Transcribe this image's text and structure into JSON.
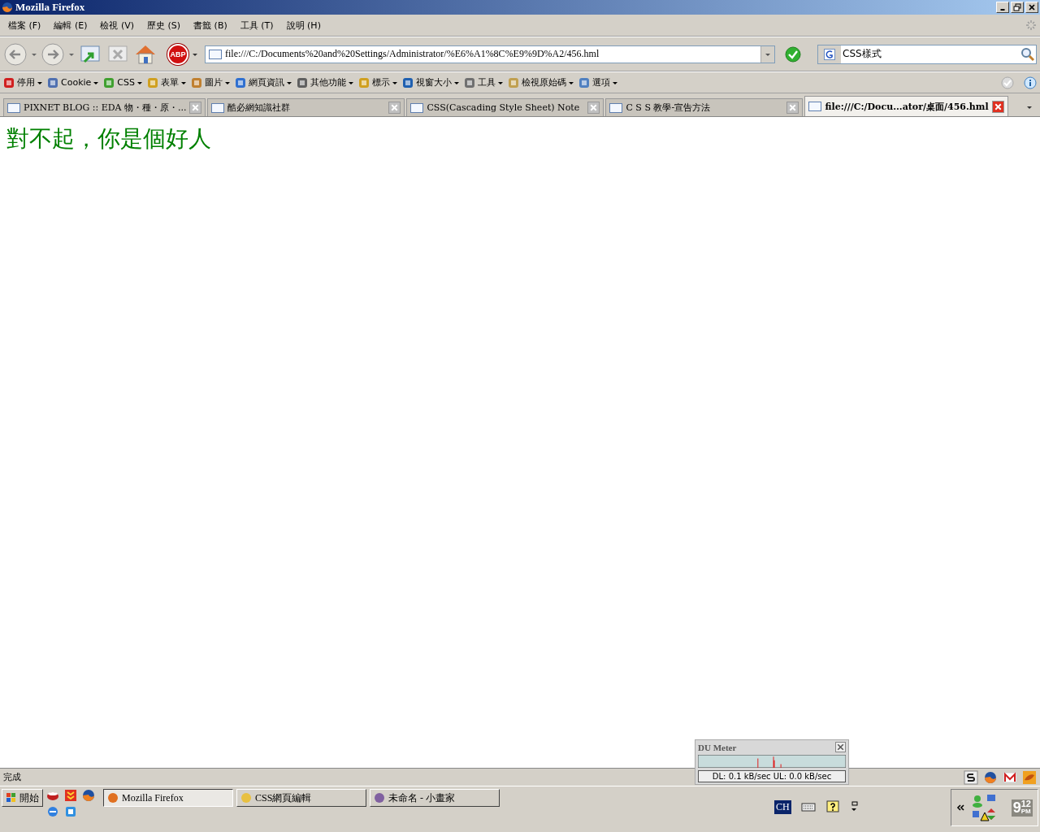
{
  "window": {
    "title": "Mozilla Firefox"
  },
  "menu": [
    "檔案 (F)",
    "編輯 (E)",
    "檢視 (V)",
    "歷史 (S)",
    "書籤 (B)",
    "工具 (T)",
    "說明 (H)"
  ],
  "navbar": {
    "adblock_label": "ABP",
    "address": "file:///C:/Documents%20and%20Settings/Administrator/%E6%A1%8C%E9%9D%A2/456.hml",
    "search_value": "CSS樣式"
  },
  "bookmarks": [
    "停用",
    "Cookie",
    "CSS",
    "表單",
    "圖片",
    "網頁資訊",
    "其他功能",
    "標示",
    "視窗大小",
    "工具",
    "檢視原始碼",
    "選項"
  ],
  "tabs": [
    {
      "label": "PIXNET BLOG :: EDA 物・種・原・...",
      "selected": false
    },
    {
      "label": "酷必網知識社群",
      "selected": false
    },
    {
      "label": "CSS(Cascading Style Sheet) Note",
      "selected": false
    },
    {
      "label": "C S S 教學-宣告方法",
      "selected": false
    },
    {
      "label": "file:///C:/Docu...ator/桌面/456.hml",
      "selected": true
    }
  ],
  "page": {
    "heading": "對不起，你是個好人"
  },
  "du_meter": {
    "title": "DU Meter",
    "reading": "DL: 0.1 kB/sec  UL: 0.0 kB/sec"
  },
  "status_bar": {
    "text": "完成"
  },
  "taskbar": {
    "start": "開始",
    "tasks": [
      {
        "label": "Mozilla Firefox",
        "selected": true
      },
      {
        "label": "CSS網頁編輯",
        "selected": false
      },
      {
        "label": "未命名 - 小畫家",
        "selected": false
      }
    ],
    "language": "CH",
    "clock_hour": "9",
    "clock_minute": "12",
    "clock_ampm": "PM"
  }
}
